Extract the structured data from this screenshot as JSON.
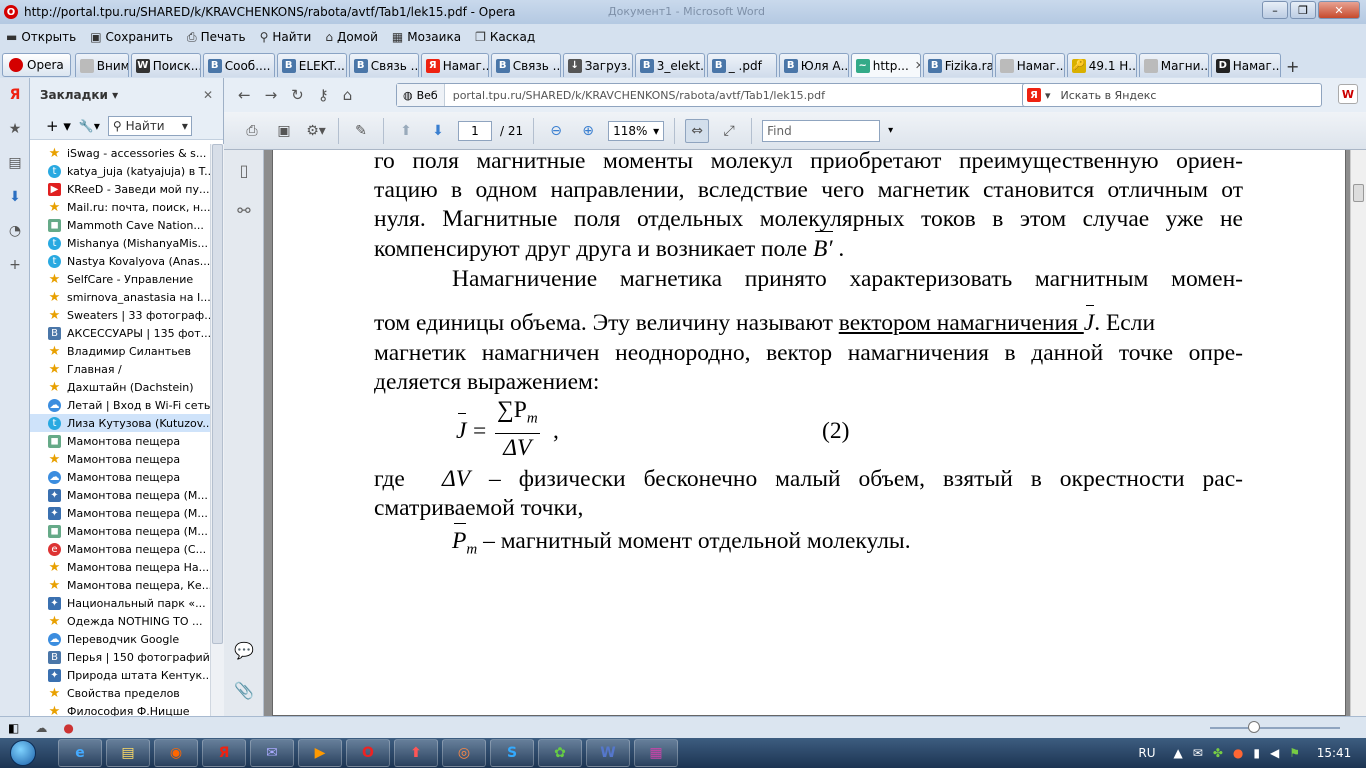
{
  "window": {
    "title": "http://portal.tpu.ru/SHARED/k/KRAVCHENKONS/rabota/avtf/Tab1/lek15.pdf - Opera",
    "background_title": "Документ1 - Microsoft Word"
  },
  "menu": [
    {
      "label": "Открыть",
      "icon": "folder-icon"
    },
    {
      "label": "Сохранить",
      "icon": "save-icon"
    },
    {
      "label": "Печать",
      "icon": "print-icon"
    },
    {
      "label": "Найти",
      "icon": "search-icon"
    },
    {
      "label": "Домой",
      "icon": "home-icon"
    },
    {
      "label": "Мозаика",
      "icon": "tile-icon"
    },
    {
      "label": "Каскад",
      "icon": "cascade-icon"
    }
  ],
  "opera_button": "Opera",
  "tabs": [
    {
      "label": "Внима...",
      "fav": "",
      "color": "#bbb"
    },
    {
      "label": "Поиск...",
      "fav": "W",
      "color": "#333"
    },
    {
      "label": "Сооб....",
      "fav": "B",
      "color": "#4a76a8"
    },
    {
      "label": "ELEKT...",
      "fav": "B",
      "color": "#4a76a8"
    },
    {
      "label": "Связь ...",
      "fav": "B",
      "color": "#4a76a8"
    },
    {
      "label": "Намаг...",
      "fav": "Я",
      "color": "#e21"
    },
    {
      "label": "Связь ...",
      "fav": "B",
      "color": "#4a76a8"
    },
    {
      "label": "Загруз...",
      "fav": "↓",
      "color": "#555"
    },
    {
      "label": "3_elekt...",
      "fav": "B",
      "color": "#4a76a8"
    },
    {
      "label": "_ .pdf",
      "fav": "B",
      "color": "#4a76a8"
    },
    {
      "label": "Юля А...",
      "fav": "B",
      "color": "#4a76a8"
    },
    {
      "label": "http...",
      "fav": "~",
      "color": "#3a8",
      "active": true
    },
    {
      "label": "Fizika.rar",
      "fav": "B",
      "color": "#4a76a8"
    },
    {
      "label": "Намаг...",
      "fav": "",
      "color": "#bbb"
    },
    {
      "label": "49.1 Н...",
      "fav": "🔑",
      "color": "#d9b000"
    },
    {
      "label": "Магни...",
      "fav": "",
      "color": "#bbb"
    },
    {
      "label": "Намаг...",
      "fav": "D",
      "color": "#222"
    }
  ],
  "bookmarks": {
    "title": "Закладки",
    "search_label": "Найти",
    "items": [
      {
        "label": "iSwag - accessories & s...",
        "icon": "star"
      },
      {
        "label": "katya_juja (katyajuja) в T...",
        "icon": "tw"
      },
      {
        "label": "KReeD - Заведи мой пу...",
        "icon": "yt"
      },
      {
        "label": "Mail.ru: почта, поиск, н...",
        "icon": "star"
      },
      {
        "label": "Mammoth Cave Nation...",
        "icon": "gr"
      },
      {
        "label": "Mishanya (MishanyaMis...",
        "icon": "tw"
      },
      {
        "label": "Nastya Kovalyova (Anas...",
        "icon": "tw"
      },
      {
        "label": "SelfCare - Управление",
        "icon": "star"
      },
      {
        "label": "smirnova_anastasia на I...",
        "icon": "star"
      },
      {
        "label": "Sweaters | 33 фотограф...",
        "icon": "star"
      },
      {
        "label": "АКСЕССУАРЫ | 135 фот...",
        "icon": "vk"
      },
      {
        "label": "Владимир Силантьев",
        "icon": "star"
      },
      {
        "label": "Главная /",
        "icon": "star"
      },
      {
        "label": "Дахштайн (Dachstein)",
        "icon": "star"
      },
      {
        "label": "Летай | Вход в Wi-Fi сеть",
        "icon": "lt"
      },
      {
        "label": "Лиза Кутузова (Kutuzov...",
        "icon": "tw",
        "selected": true
      },
      {
        "label": "Мамонтова пещера",
        "icon": "gr"
      },
      {
        "label": "Мамонтова пещера",
        "icon": "star"
      },
      {
        "label": "Мамонтова пещера",
        "icon": "lt"
      },
      {
        "label": "Мамонтова пещера (М...",
        "icon": "ms"
      },
      {
        "label": "Мамонтова пещера (М...",
        "icon": "ms"
      },
      {
        "label": "Мамонтова пещера (М...",
        "icon": "gr"
      },
      {
        "label": "Мамонтова пещера (С...",
        "icon": "rd"
      },
      {
        "label": "Мамонтова пещера На...",
        "icon": "star"
      },
      {
        "label": "Мамонтова пещера, Ке...",
        "icon": "star"
      },
      {
        "label": "Национальный парк «...",
        "icon": "ms"
      },
      {
        "label": "Одежда NOTHING TO ...",
        "icon": "star"
      },
      {
        "label": "Переводчик Google",
        "icon": "lt"
      },
      {
        "label": "Перья | 150 фотографий",
        "icon": "vk"
      },
      {
        "label": "Природа штата Кентук...",
        "icon": "ms"
      },
      {
        "label": "Свойства пределов",
        "icon": "star"
      },
      {
        "label": "Философия Ф.Ницше",
        "icon": "star"
      }
    ]
  },
  "address": {
    "prefix": "Веб",
    "url": "portal.tpu.ru/SHARED/k/KRAVCHENKONS/rabota/avtf/Tab1/lek15.pdf",
    "search_placeholder": "Искать в Яндекс"
  },
  "pdf_toolbar": {
    "page": "1",
    "total": "/ 21",
    "zoom": "118%",
    "find_placeholder": "Find"
  },
  "pdf": {
    "line1": "го поля магнитные моменты молекул приобретают преимущественную ориен-",
    "line2": "тацию в одном направлении, вследствие чего магнетик становится отличным от",
    "line3": "нуля. Магнитные поля отдельных молекулярных токов в этом случае уже не",
    "line4a": "компенсируют друг друга и возникает поле ",
    "line4b": "B′",
    "line4c": " .",
    "line5": "Намагничение магнетика принято характеризовать магнитным момен-",
    "line6a": "том единицы объема. Эту величину называют ",
    "line6b": "вектором намагничения ",
    "line6c": "J",
    "line6d": ". Если",
    "line7": "магнетик намагничен неоднородно, вектор намагничения в данной точке опре-",
    "line8": "деляется выражением:",
    "formula_lhs": "J",
    "formula_eq": "=",
    "formula_num": "∑P",
    "formula_num_sub": "m",
    "formula_den": "ΔV",
    "formula_comma": ",",
    "formula_no": "(2)",
    "line9a": "где",
    "line9b": "ΔV",
    "line9c": "– физически бесконечно малый объем, взятый в окрестности рас-",
    "line10": "сматриваемой точки,",
    "line11a": "P",
    "line11b": "m",
    "line11c": " – магнитный момент отдельной молекулы."
  },
  "taskbar": {
    "apps": [
      "IE",
      "Проводник",
      "Chrome",
      "Яндекс",
      "Почта",
      "Медиа",
      "Opera",
      "Загрузка",
      "Aurora",
      "Skype",
      "Агент",
      "Word",
      "WinRAR"
    ],
    "lang": "RU",
    "time": "15:41"
  }
}
